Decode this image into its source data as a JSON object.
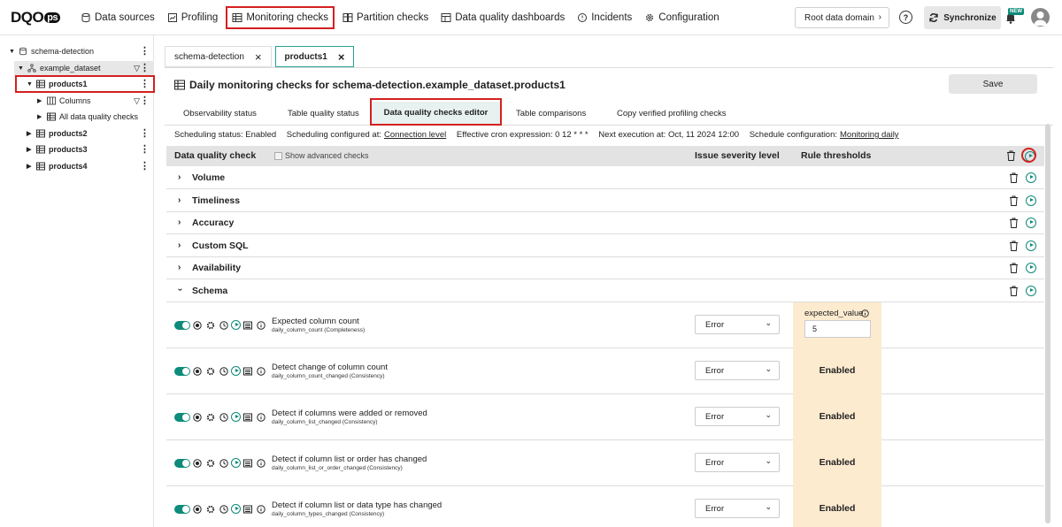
{
  "brand": {
    "logo_main": "DQO",
    "logo_ops": "ps"
  },
  "nav": {
    "items": [
      {
        "label": "Data sources",
        "icon": "database-icon"
      },
      {
        "label": "Profiling",
        "icon": "profiling-icon"
      },
      {
        "label": "Monitoring checks",
        "icon": "table-icon"
      },
      {
        "label": "Partition checks",
        "icon": "partition-icon"
      },
      {
        "label": "Data quality dashboards",
        "icon": "dashboard-icon"
      },
      {
        "label": "Incidents",
        "icon": "alert-icon"
      },
      {
        "label": "Configuration",
        "icon": "gear-icon"
      }
    ],
    "root_domain": "Root data domain",
    "help": "?",
    "sync_label": "Synchronize",
    "new_badge": "NEW"
  },
  "tree": {
    "connection": "schema-detection",
    "schema": "example_dataset",
    "tables": [
      "products1",
      "products2",
      "products3",
      "products4"
    ],
    "columns_label": "Columns",
    "all_checks_label": "All data quality checks"
  },
  "tabs": [
    {
      "label": "schema-detection"
    },
    {
      "label": "products1"
    }
  ],
  "page_title": "Daily monitoring checks for schema-detection.example_dataset.products1",
  "save_label": "Save",
  "subtabs": [
    "Observability status",
    "Table quality status",
    "Data quality checks editor",
    "Table comparisons",
    "Copy verified profiling checks"
  ],
  "schedule": {
    "status": "Scheduling status: Enabled",
    "configured_prefix": "Scheduling configured at:",
    "configured_link": "Connection level",
    "cron": "Effective cron expression: 0 12 * * *",
    "next": "Next execution at: Oct, 11 2024 12:00",
    "config_prefix": "Schedule configuration:",
    "config_link": "Monitoring daily"
  },
  "grid": {
    "col_check": "Data quality check",
    "show_advanced": "Show advanced checks",
    "col_severity": "Issue severity level",
    "col_thresholds": "Rule thresholds"
  },
  "categories": [
    "Volume",
    "Timeliness",
    "Accuracy",
    "Custom SQL",
    "Availability",
    "Schema"
  ],
  "checks": [
    {
      "name": "Expected column count",
      "sub": "daily_column_count (Completeness)",
      "severity": "Error",
      "param_label": "expected_value",
      "param_value": "5"
    },
    {
      "name": "Detect change of column count",
      "sub": "daily_column_count_changed (Consistency)",
      "severity": "Error",
      "threshold": "Enabled"
    },
    {
      "name": "Detect if columns were added or removed",
      "sub": "daily_column_list_changed (Consistency)",
      "severity": "Error",
      "threshold": "Enabled"
    },
    {
      "name": "Detect if column list or order has changed",
      "sub": "daily_column_list_or_order_changed (Consistency)",
      "severity": "Error",
      "threshold": "Enabled"
    },
    {
      "name": "Detect if column list or data type has changed",
      "sub": "daily_column_types_changed (Consistency)",
      "severity": "Error",
      "threshold": "Enabled"
    }
  ],
  "colors": {
    "accent": "#0e8b7a",
    "highlight": "#d42020",
    "threshold_bg": "#fdebd0"
  }
}
